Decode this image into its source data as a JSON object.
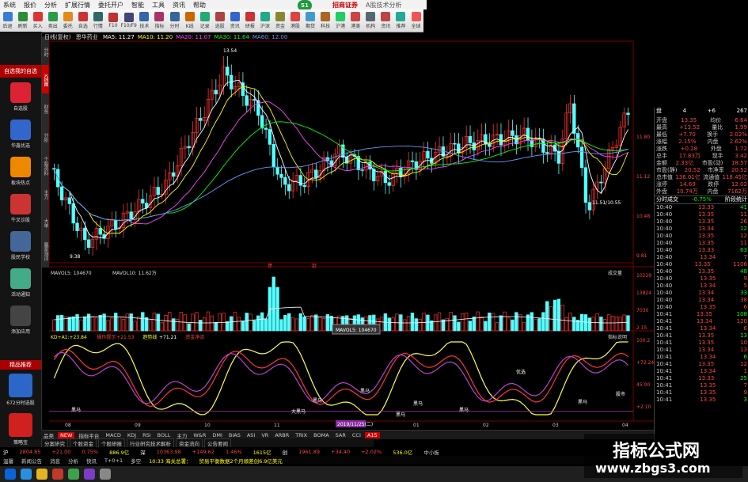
{
  "menu": {
    "items": [
      "系统",
      "报价",
      "分析",
      "扩展行情",
      "委托开户",
      "智能",
      "工具",
      "资讯",
      "帮助"
    ],
    "brand": "招商证券",
    "badge": "51",
    "product_label": "A股技术分析"
  },
  "toolbar": {
    "items": [
      "后退",
      "刷新",
      "买入",
      "卖出",
      "委托",
      "自选",
      "行情",
      "F10",
      "F10/F9",
      "技术",
      "指标",
      "分时",
      "K线",
      "记录",
      "选股",
      "资讯",
      "研报",
      "沪深",
      "资金",
      "港股",
      "期货",
      "科技",
      "沪港",
      "港美",
      "机构",
      "资讯",
      "推荐",
      "全球"
    ]
  },
  "sidebar": {
    "top_label": "自选我的自选",
    "items": [
      {
        "label": "自选股",
        "color": "#d23"
      },
      {
        "label": "华鑫优选",
        "color": "#36c"
      },
      {
        "label": "板块热点",
        "color": "#e80"
      },
      {
        "label": "牛叉诊股",
        "color": "#c33"
      },
      {
        "label": "股民学校",
        "color": "#469"
      },
      {
        "label": "活动通知",
        "color": "#4a8"
      },
      {
        "label": "添加应用",
        "color": "#444"
      }
    ],
    "promo": "精品推荐",
    "apps": [
      {
        "label": "672分时选股",
        "color": "#2b66c8"
      },
      {
        "label": "策略宝",
        "color": "#d02020"
      }
    ]
  },
  "vtabs": [
    "分时",
    "K线图",
    "财务",
    "分析",
    "个股资料",
    "主力",
    "大单",
    "赢家测评"
  ],
  "chart": {
    "title_prefix": "日线(复权)",
    "name": "恩华药业",
    "ma_legend": [
      {
        "label": "MA5: 11.27",
        "color": "#ffffff"
      },
      {
        "label": "MA10: 11.20",
        "color": "#ffff00"
      },
      {
        "label": "MA20: 11.07",
        "color": "#ff44ff"
      },
      {
        "label": "MA30: 11.64",
        "color": "#00ff00"
      },
      {
        "label": "MA60: 12.00",
        "color": "#6699ff"
      }
    ],
    "high_label": "13.54",
    "low_label": "9.38",
    "right_low_label": "11.51/10.55",
    "price_axis": [
      "11.80",
      "11.12",
      "10.48",
      "9.81"
    ],
    "vol_legend": "MAVOL5: 104670",
    "vol_legend2": "MAVOL10: 11.62万",
    "vol_tag": "成交量",
    "vol_axis": [
      "10229",
      "13824",
      "7030",
      "2.15"
    ],
    "tooltip": "MAVOL5: 104670",
    "ind_legend": [
      {
        "label": "KD+A1:+23.84",
        "color": "#ffff00"
      },
      {
        "label": "操作提示",
        "color": "#ff4444"
      },
      {
        "label": "+21.53",
        "color": "#ff4444"
      },
      {
        "label": "趋势线",
        "color": "#ff0"
      },
      {
        "label": "+71.21",
        "color": "#ffffff"
      },
      {
        "label": "资金净流",
        "color": "#ff4444"
      }
    ],
    "ind_tag": "指标说明",
    "ind_axis": [
      "100.2",
      "+72.24",
      "45.00",
      "+2.10"
    ],
    "ind_labels": [
      "黑马",
      "大黑马",
      "黑马",
      "黑马",
      "黑马",
      "黑马",
      "黑马",
      "黑马",
      "优选",
      "股市"
    ],
    "date_axis": [
      "08",
      "09",
      "10",
      "11",
      "12",
      "01",
      "02",
      "03",
      "04"
    ],
    "date_highlight": "2019/11/25(二)",
    "signal_tags": [
      "停",
      "封"
    ]
  },
  "right_panel": {
    "header": [
      "盘",
      "4",
      "+6",
      "267"
    ],
    "quotes": [
      [
        "开盘",
        "13.35",
        "均价",
        "6.64"
      ],
      [
        "最高",
        "+13.52",
        "量比",
        "1.99"
      ],
      [
        "最低",
        "+7.70",
        "换手",
        "2.02%"
      ],
      [
        "涨幅",
        "2.15%",
        "内盘",
        "2.62%"
      ],
      [
        "涨跌",
        "+0.28",
        "外盘",
        "1.72"
      ],
      [
        "总手",
        "17.83万",
        "现手",
        "3.42"
      ],
      [
        "金额",
        "2.33亿",
        "市盈(动)",
        "18.57"
      ],
      [
        "市盈(静)",
        "20.52",
        "市净率",
        "20.52"
      ],
      [
        "总市值",
        "136.01亿",
        "流通值",
        "118.45亿"
      ],
      [
        "涨停",
        "14.69",
        "跌停",
        "12.02"
      ],
      [
        "外盘",
        "10.74万",
        "内盘",
        "7162万"
      ]
    ],
    "trade_header": [
      "分时成交",
      "-0.75%",
      "阶段统计"
    ],
    "trades": [
      [
        "10:40",
        "13.33",
        "41"
      ],
      [
        "10:40",
        "13.35",
        "11"
      ],
      [
        "10:40",
        "13.35",
        "26"
      ],
      [
        "10:40",
        "13.34",
        "12"
      ],
      [
        "10:40",
        "13.35",
        "12"
      ],
      [
        "10:40",
        "13.35",
        "11"
      ],
      [
        "10:40",
        "13.33",
        "63"
      ],
      [
        "10:40",
        "13.34",
        "7"
      ],
      [
        "10:40",
        "13.35",
        "1106"
      ],
      [
        "10:40",
        "13.35",
        "48"
      ],
      [
        "10:40",
        "13.35",
        "9"
      ],
      [
        "10:40",
        "13.34",
        "5"
      ],
      [
        "10:40",
        "13.34",
        "33"
      ],
      [
        "10:40",
        "13.34",
        "38"
      ],
      [
        "10:40",
        "13.35",
        "6"
      ],
      [
        "10:41",
        "13.35",
        "108"
      ],
      [
        "10:41",
        "13.34",
        "120"
      ],
      [
        "10:41",
        "13.34",
        "6"
      ],
      [
        "10:41",
        "13.35",
        "13"
      ],
      [
        "10:41",
        "13.35",
        "10"
      ],
      [
        "10:41",
        "13.34",
        "13"
      ],
      [
        "10:41",
        "13.34",
        "6"
      ],
      [
        "10:41",
        "13.35",
        "12"
      ],
      [
        "10:41",
        "13.34",
        "1"
      ],
      [
        "10:41",
        "13.33",
        "25"
      ],
      [
        "10:41",
        "13.35",
        "7"
      ],
      [
        "10:41",
        "13.35",
        "9"
      ],
      [
        "10:41",
        "13.35",
        "3"
      ]
    ]
  },
  "bottom_tabs": [
    "品类",
    "NEW",
    "指标平台",
    "MACD",
    "KDJ",
    "RSI",
    "BOLL",
    "主力",
    "W&R",
    "DMI",
    "BIAS",
    "ASI",
    "VR",
    "ARBR",
    "TRIX",
    "BOMA",
    "SAR",
    "CCI",
    "A15"
  ],
  "bottom_active": "A15",
  "sub_tabs": [
    "分案研究",
    "个股资金",
    "个股研报",
    "行业研究技术解析",
    "资金流向",
    "公告要闻"
  ],
  "status": {
    "index_name": "沪",
    "index_val": "2804.85",
    "index_chg": "+21.00",
    "index_pct": "0.75%",
    "amt": "886.9亿",
    "sz_name": "深",
    "sz_val": "10363.98",
    "sz_chg": "+149.62",
    "sz_pct": "1.46%",
    "cy_val": "1615亿",
    "cy_name": "创",
    "cy_idx": "1961.89",
    "cy_chg": "+34.40",
    "cy_pct": "+2.02%",
    "cy_amt": "536.0亿",
    "tail": "中小板"
  },
  "info": {
    "items": [
      "温馨",
      "新闻公告",
      "消息",
      "分析",
      "快讯",
      "T+0+1",
      "多空"
    ],
    "news_time": "10:33 海关总署：",
    "news": "贸易平衡数据2个月顺差创6.9亿美元"
  },
  "watermark": {
    "line1": "指标公式网",
    "line2": "www.zbgs3.com"
  }
}
